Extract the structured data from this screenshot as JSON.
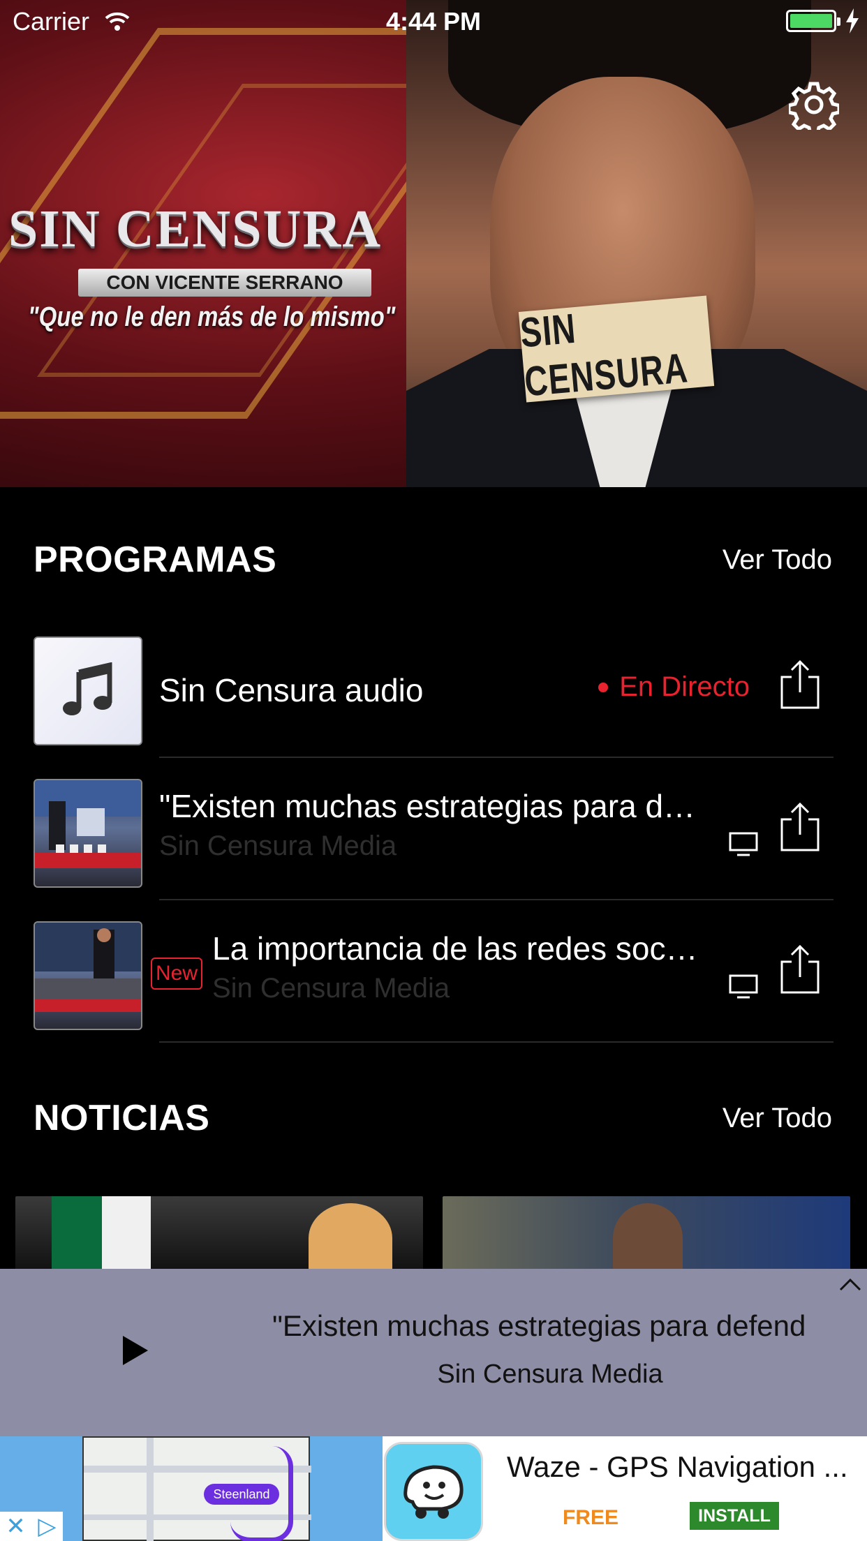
{
  "status_bar": {
    "carrier": "Carrier",
    "time": "4:44 PM"
  },
  "hero": {
    "logo": "SIN CENSURA",
    "logo_sub": "CON VICENTE SERRANO",
    "tagline": "\"Que no le den más de lo mismo\"",
    "tape_text": "SIN CENSURA"
  },
  "programas": {
    "title": "PROGRAMAS",
    "see_all": "Ver Todo",
    "items": [
      {
        "title": "Sin Censura audio",
        "live_label": "En Directo",
        "icon": "music-note-icon"
      },
      {
        "title": "\"Existen muchas estrategias para d…",
        "subtitle": "Sin Censura Media",
        "icon": "tv-icon"
      },
      {
        "badge": "New",
        "title": "La importancia de las redes soc…",
        "subtitle": "Sin Censura Media",
        "icon": "tv-icon"
      }
    ]
  },
  "noticias": {
    "title": "NOTICIAS",
    "see_all": "Ver Todo"
  },
  "player": {
    "title": "\"Existen muchas estrategias para defend",
    "subtitle": "Sin Censura Media"
  },
  "ad": {
    "map_label": "Steenland",
    "title": "Waze - GPS Navigation ...",
    "price": "FREE",
    "cta": "INSTALL"
  },
  "colors": {
    "live_red": "#e8232f",
    "player_bg": "#8e8da6",
    "battery_green": "#4cd964",
    "install_green": "#2c8a2c",
    "price_orange": "#f08a1c"
  }
}
